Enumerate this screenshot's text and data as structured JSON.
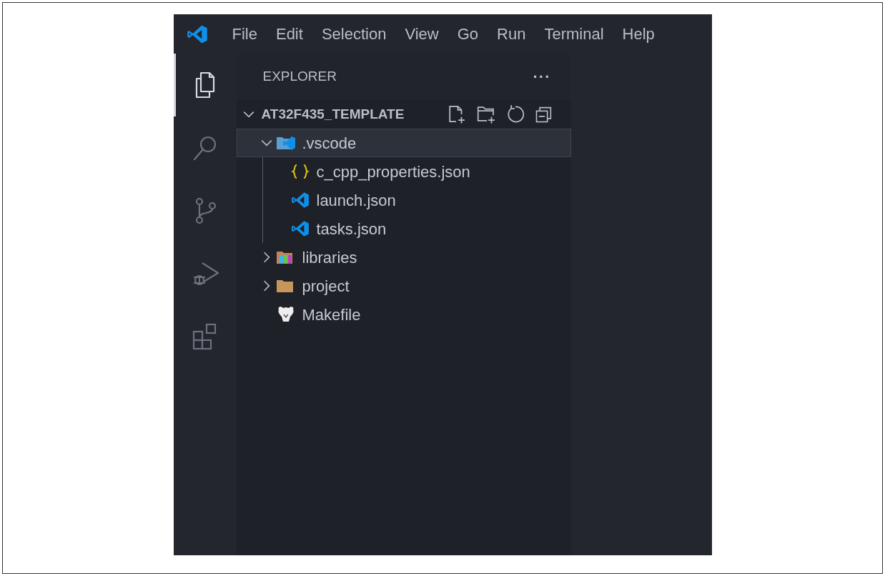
{
  "menu": [
    "File",
    "Edit",
    "Selection",
    "View",
    "Go",
    "Run",
    "Terminal",
    "Help"
  ],
  "activity_bar": [
    {
      "kind": "explorer",
      "selected": true
    },
    {
      "kind": "search",
      "selected": false
    },
    {
      "kind": "source-control",
      "selected": false
    },
    {
      "kind": "run-debug",
      "selected": false
    },
    {
      "kind": "extensions",
      "selected": false
    }
  ],
  "explorer": {
    "title": "EXPLORER",
    "more": "···",
    "root": {
      "label": "AT32F435_TEMPLATE",
      "expanded": true
    },
    "tree": [
      {
        "label": ".vscode",
        "kind": "vscode-folder",
        "expanded": true,
        "selected": true,
        "children": [
          {
            "label": "c_cpp_properties.json",
            "kind": "json",
            "selected": false
          },
          {
            "label": "launch.json",
            "kind": "vscode-file",
            "selected": false
          },
          {
            "label": "tasks.json",
            "kind": "vscode-file",
            "selected": false
          }
        ]
      },
      {
        "label": "libraries",
        "kind": "library-folder",
        "expanded": false,
        "selected": false
      },
      {
        "label": "project",
        "kind": "folder",
        "expanded": false,
        "selected": false
      },
      {
        "label": "Makefile",
        "kind": "makefile",
        "selected": false
      }
    ]
  }
}
